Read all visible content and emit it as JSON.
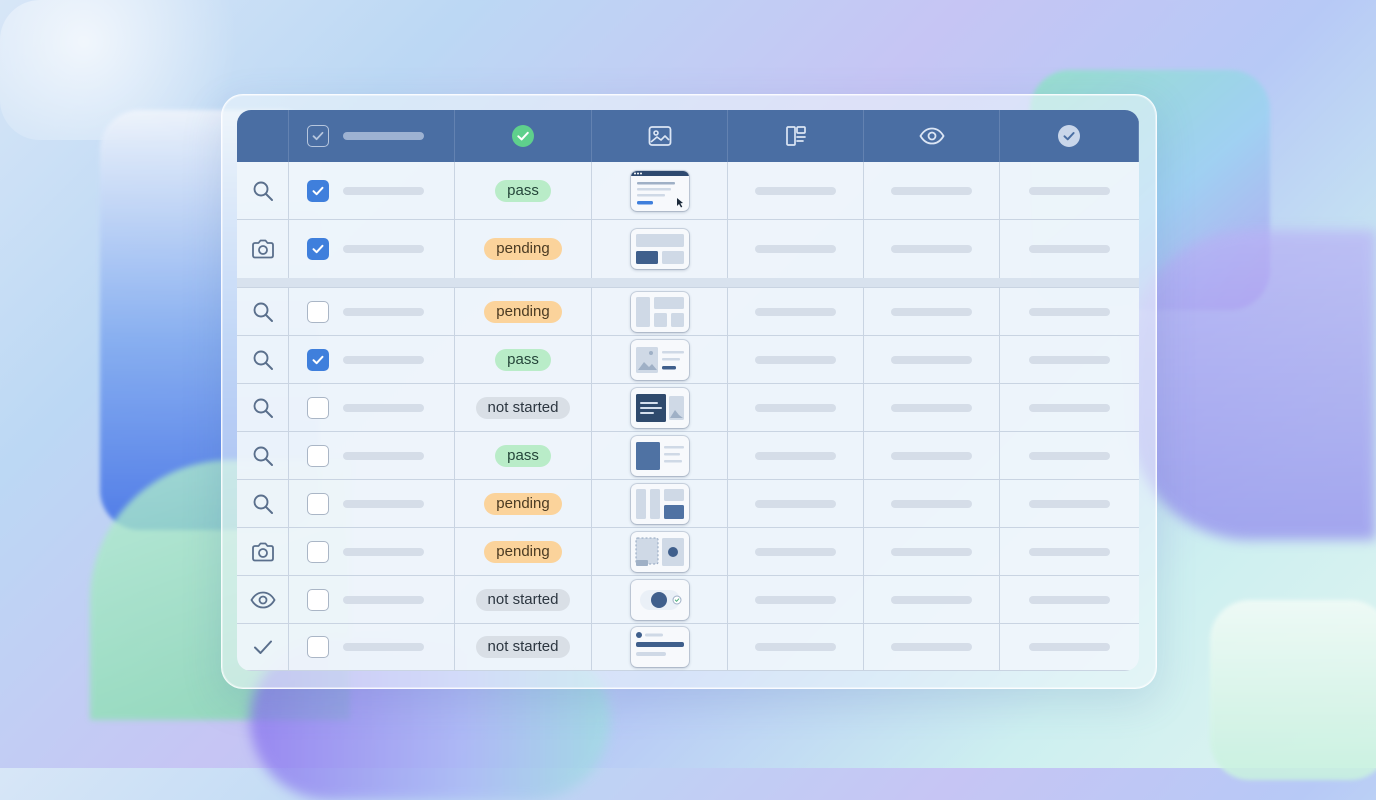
{
  "header": {
    "icons": [
      "checkbox-icon",
      "check-circle-icon",
      "image-icon",
      "layout-icon",
      "eye-icon",
      "check-badge-icon"
    ]
  },
  "rows": [
    {
      "icon": "search-icon",
      "checked": true,
      "status": "pass",
      "status_kind": "pass",
      "thumb": "webpage-cursor"
    },
    {
      "icon": "camera-icon",
      "checked": true,
      "status": "pending",
      "status_kind": "pending",
      "thumb": "banner-blocks"
    },
    {
      "icon": "search-icon",
      "checked": false,
      "status": "pending",
      "status_kind": "pending",
      "thumb": "grid-layout"
    },
    {
      "icon": "search-icon",
      "checked": true,
      "status": "pass",
      "status_kind": "pass",
      "thumb": "image-text"
    },
    {
      "icon": "search-icon",
      "checked": false,
      "status": "not started",
      "status_kind": "notstarted",
      "thumb": "dark-card-image"
    },
    {
      "icon": "search-icon",
      "checked": false,
      "status": "pass",
      "status_kind": "pass",
      "thumb": "block-lines"
    },
    {
      "icon": "search-icon",
      "checked": false,
      "status": "pending",
      "status_kind": "pending",
      "thumb": "columns-layout"
    },
    {
      "icon": "camera-icon",
      "checked": false,
      "status": "pending",
      "status_kind": "pending",
      "thumb": "dashed-dot"
    },
    {
      "icon": "eye-icon",
      "checked": false,
      "status": "not started",
      "status_kind": "notstarted",
      "thumb": "toggle"
    },
    {
      "icon": "check-icon",
      "checked": false,
      "status": "not started",
      "status_kind": "notstarted",
      "thumb": "list-button"
    }
  ],
  "colors": {
    "header_bg": "#4a6ea3",
    "checkbox_on": "#3f7fdc",
    "pass_bg": "#b9ecc8",
    "pending_bg": "#fbd39b",
    "not_started_bg": "#d9dfe6"
  }
}
